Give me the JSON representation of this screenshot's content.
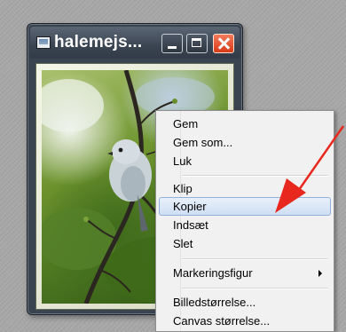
{
  "window": {
    "title": "halemejs...",
    "buttons": {
      "minimize": "minimize",
      "maximize": "maximize",
      "close": "close"
    },
    "image": "photo of a small grey bird on a branch with green foliage"
  },
  "context_menu": {
    "items": [
      {
        "label": "Gem",
        "highlighted": false
      },
      {
        "label": "Gem som...",
        "highlighted": false
      },
      {
        "label": "Luk",
        "highlighted": false
      },
      {
        "separator": true
      },
      {
        "label": "Klip",
        "highlighted": false
      },
      {
        "label": "Kopier",
        "highlighted": true
      },
      {
        "label": "Indsæt",
        "highlighted": false
      },
      {
        "label": "Slet",
        "highlighted": false
      },
      {
        "separator": true
      },
      {
        "label": "Markeringsfigur",
        "highlighted": false,
        "submenu": true
      },
      {
        "separator": true
      },
      {
        "label": "Billedstørrelse...",
        "highlighted": false
      },
      {
        "label": "Canvas størrelse...",
        "highlighted": false
      }
    ]
  },
  "annotation": {
    "arrow_color": "#e8281e"
  },
  "colors": {
    "menu_highlight": "#cfdef3",
    "close_button": "#d93a17",
    "title_bar": "#3b4552"
  }
}
